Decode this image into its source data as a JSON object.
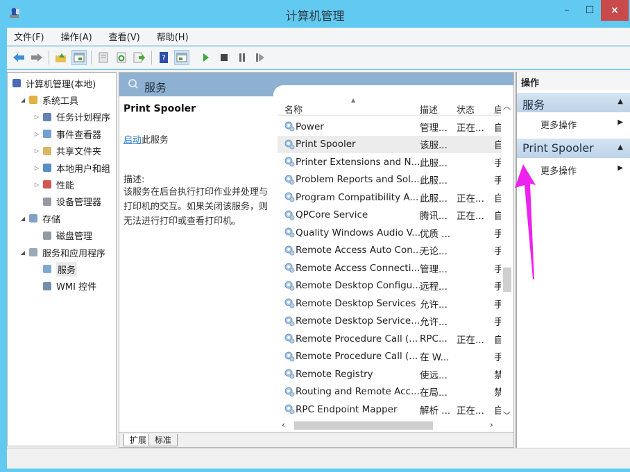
{
  "window": {
    "title": "计算机管理",
    "controls": {
      "minimize": "–",
      "maximize": "☐",
      "close": "×"
    }
  },
  "menubar": {
    "items": [
      "文件(F)",
      "操作(A)",
      "查看(V)",
      "帮助(H)"
    ]
  },
  "toolbar": {
    "buttons": [
      "back-icon",
      "forward-icon",
      "up-folder-icon",
      "show-hide-tree-icon",
      "properties-icon",
      "refresh-icon",
      "export-list-icon",
      "help-icon",
      "show-hide-action-pane-icon",
      "start-service-icon",
      "stop-service-icon",
      "pause-service-icon",
      "restart-service-icon"
    ]
  },
  "tree": {
    "items": [
      {
        "label": "计算机管理(本地)",
        "level": 0,
        "expander": ""
      },
      {
        "label": "系统工具",
        "level": 1,
        "expander": "◢"
      },
      {
        "label": "任务计划程序",
        "level": 2,
        "expander": "▷"
      },
      {
        "label": "事件查看器",
        "level": 2,
        "expander": "▷"
      },
      {
        "label": "共享文件夹",
        "level": 2,
        "expander": "▷"
      },
      {
        "label": "本地用户和组",
        "level": 2,
        "expander": "▷"
      },
      {
        "label": "性能",
        "level": 2,
        "expander": "▷"
      },
      {
        "label": "设备管理器",
        "level": 2,
        "expander": ""
      },
      {
        "label": "存储",
        "level": 1,
        "expander": "◢"
      },
      {
        "label": "磁盘管理",
        "level": 2,
        "expander": ""
      },
      {
        "label": "服务和应用程序",
        "level": 1,
        "expander": "◢"
      },
      {
        "label": "服务",
        "level": 2,
        "expander": "",
        "selected": true
      },
      {
        "label": "WMI 控件",
        "level": 2,
        "expander": ""
      }
    ]
  },
  "center": {
    "header_title": "服务",
    "detail": {
      "service_name": "Print Spooler",
      "start_link": "启动",
      "start_suffix": "此服务",
      "desc_label": "描述:",
      "desc_text": "该服务在后台执行打印作业并处理与打印机的交互。如果关闭该服务，则无法进行打印或查看打印机。"
    },
    "columns": {
      "name": "名称",
      "desc": "描述",
      "status": "状态",
      "start": "启"
    },
    "rows": [
      {
        "name": "Power",
        "desc": "管理...",
        "status": "正在...",
        "start": "自"
      },
      {
        "name": "Print Spooler",
        "desc": "该服...",
        "status": "",
        "start": "自",
        "selected": true
      },
      {
        "name": "Printer Extensions and N...",
        "desc": "此服...",
        "status": "",
        "start": "手"
      },
      {
        "name": "Problem Reports and Sol...",
        "desc": "此服...",
        "status": "",
        "start": "手"
      },
      {
        "name": "Program Compatibility A...",
        "desc": "此服...",
        "status": "正在...",
        "start": "自"
      },
      {
        "name": "QPCore Service",
        "desc": "腾讯...",
        "status": "正在...",
        "start": "自"
      },
      {
        "name": "Quality Windows Audio V...",
        "desc": "优质 ...",
        "status": "",
        "start": "手"
      },
      {
        "name": "Remote Access Auto Con...",
        "desc": "无论...",
        "status": "",
        "start": "手"
      },
      {
        "name": "Remote Access Connecti...",
        "desc": "管理...",
        "status": "",
        "start": "手"
      },
      {
        "name": "Remote Desktop Configu...",
        "desc": "远程...",
        "status": "",
        "start": "手"
      },
      {
        "name": "Remote Desktop Services",
        "desc": "允许...",
        "status": "",
        "start": "手"
      },
      {
        "name": "Remote Desktop Service...",
        "desc": "允许...",
        "status": "",
        "start": "手"
      },
      {
        "name": "Remote Procedure Call (...",
        "desc": "RPC...",
        "status": "正在...",
        "start": "自"
      },
      {
        "name": "Remote Procedure Call (...",
        "desc": "在 W...",
        "status": "",
        "start": "手"
      },
      {
        "name": "Remote Registry",
        "desc": "使远...",
        "status": "",
        "start": "禁"
      },
      {
        "name": "Routing and Remote Acc...",
        "desc": "在局...",
        "status": "",
        "start": "禁"
      },
      {
        "name": "RPC Endpoint Mapper",
        "desc": "解析 ...",
        "status": "正在...",
        "start": "自"
      }
    ],
    "bottom_tabs": [
      "扩展",
      "标准"
    ]
  },
  "actions": {
    "title": "操作",
    "sections": [
      {
        "title": "服务",
        "items": [
          "更多操作"
        ]
      },
      {
        "title": "Print Spooler",
        "items": [
          "更多操作"
        ]
      }
    ]
  },
  "colors": {
    "titlebar": "#62caf0",
    "close_button": "#c94a4a",
    "header_blue": "#8fb1d1",
    "link": "#2b7cd3",
    "annotation": "#ee22ee"
  }
}
